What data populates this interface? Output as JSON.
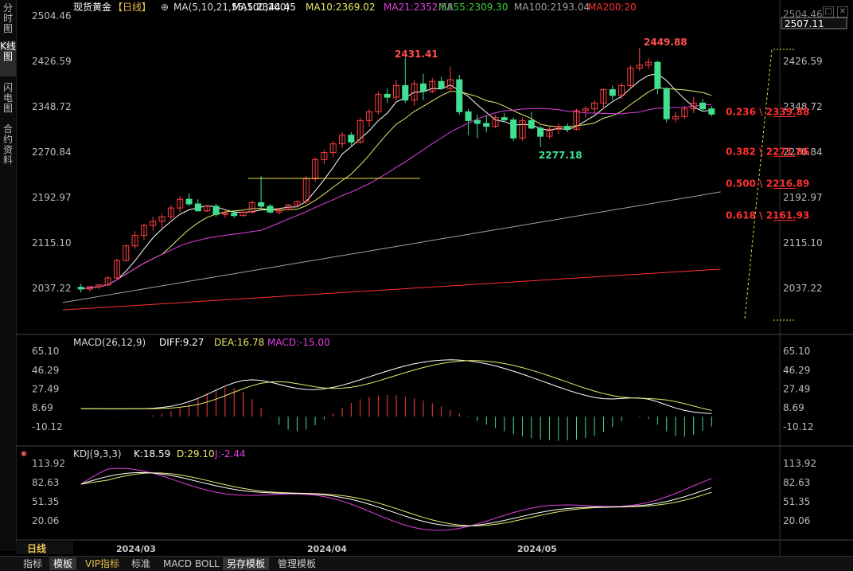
{
  "left_tabs": [
    {
      "label": "分时图",
      "active": false
    },
    {
      "label": "K线图",
      "active": true
    },
    {
      "label": "闪电图",
      "active": false
    },
    {
      "label": "合约资料",
      "active": false
    }
  ],
  "header": {
    "symbol": "现货黄金",
    "period": "【日线】",
    "settings_glyph": "⊕",
    "ma_params": "MA(5,10,21,55,100,200)",
    "ma": [
      {
        "label": "MA5:2344.45",
        "color": "#ffffff"
      },
      {
        "label": "MA10:2369.02",
        "color": "#e8e86a"
      },
      {
        "label": "MA21:2352.58",
        "color": "#e040e0"
      },
      {
        "label": "MA55:2309.30",
        "color": "#40d040"
      },
      {
        "label": "MA100:2193.04",
        "color": "#a0a0a0"
      },
      {
        "label": "MA200:20",
        "color": "#ff3030"
      }
    ]
  },
  "price_axis": {
    "ticks": [
      "2504.46",
      "2426.59",
      "2348.72",
      "2270.84",
      "2192.97",
      "2115.10",
      "2037.22"
    ],
    "current": "2507.11",
    "top_partial": "2504.46"
  },
  "annotations": {
    "high1": "2431.41",
    "high2": "2449.88",
    "low": "2277.18"
  },
  "fib": [
    {
      "ratio": "0.236",
      "value": "2339.88",
      "label": "0.236 \\ 2339.88"
    },
    {
      "ratio": "0.382",
      "value": "2271.86",
      "label": "0.382 \\ 2271.86"
    },
    {
      "ratio": "0.500",
      "value": "2216.89",
      "label": "0.500 \\ 2216.89"
    },
    {
      "ratio": "0.618",
      "value": "2161.93",
      "label": "0.618 \\ 2161.93"
    }
  ],
  "macd": {
    "title": "MACD(26,12,9)",
    "diff": "DIFF:9.27",
    "dea": "DEA:16.78",
    "macd": "MACD:-15.00",
    "ticks": [
      "65.10",
      "46.29",
      "27.49",
      "8.69",
      "-10.12"
    ],
    "colors": {
      "diff": "#ffffff",
      "dea": "#e8e86a",
      "macd": "#e040e0"
    }
  },
  "kdj": {
    "title": "KDJ(9,3,3)",
    "k": "K:18.59",
    "d": "D:29.10",
    "j": "J:-2.44",
    "ticks": [
      "113.92",
      "82.63",
      "51.35",
      "20.06"
    ],
    "colors": {
      "k": "#ffffff",
      "d": "#e8e86a",
      "j": "#e040e0"
    }
  },
  "time_axis": {
    "labels": [
      "2024/03",
      "2024/04",
      "2024/05"
    ],
    "period_label": "日线"
  },
  "bottom_tabs": [
    {
      "label": "指标",
      "active": false
    },
    {
      "label": "模板",
      "active": true
    },
    {
      "label": "VIP指标",
      "active": false,
      "vip": true
    },
    {
      "label": "标准",
      "active": false
    },
    {
      "label": "MACD",
      "active": false
    },
    {
      "label": "BOLL",
      "active": false
    },
    {
      "label": "另存模板",
      "active": true
    },
    {
      "label": "管理模板",
      "active": false
    }
  ],
  "colors": {
    "up": "#ff4040",
    "down": "#40e090",
    "bg": "#000000"
  },
  "candles": [
    [
      2039,
      2045,
      2030,
      2036
    ],
    [
      2036,
      2041,
      2032,
      2040
    ],
    [
      2040,
      2044,
      2036,
      2043
    ],
    [
      2043,
      2058,
      2041,
      2055
    ],
    [
      2055,
      2088,
      2053,
      2085
    ],
    [
      2085,
      2112,
      2083,
      2110
    ],
    [
      2110,
      2135,
      2105,
      2128
    ],
    [
      2128,
      2148,
      2120,
      2145
    ],
    [
      2145,
      2160,
      2136,
      2152
    ],
    [
      2152,
      2165,
      2140,
      2160
    ],
    [
      2160,
      2180,
      2155,
      2175
    ],
    [
      2175,
      2195,
      2168,
      2190
    ],
    [
      2190,
      2200,
      2178,
      2182
    ],
    [
      2182,
      2190,
      2170,
      2170
    ],
    [
      2170,
      2180,
      2168,
      2178
    ],
    [
      2178,
      2182,
      2160,
      2164
    ],
    [
      2164,
      2172,
      2158,
      2166
    ],
    [
      2166,
      2170,
      2158,
      2162
    ],
    [
      2162,
      2172,
      2160,
      2168
    ],
    [
      2168,
      2188,
      2165,
      2184
    ],
    [
      2184,
      2230,
      2172,
      2178
    ],
    [
      2178,
      2182,
      2165,
      2168
    ],
    [
      2168,
      2175,
      2164,
      2172
    ],
    [
      2172,
      2182,
      2170,
      2180
    ],
    [
      2180,
      2188,
      2176,
      2186
    ],
    [
      2186,
      2230,
      2182,
      2225
    ],
    [
      2225,
      2262,
      2220,
      2258
    ],
    [
      2258,
      2275,
      2250,
      2270
    ],
    [
      2270,
      2290,
      2262,
      2285
    ],
    [
      2285,
      2305,
      2278,
      2300
    ],
    [
      2300,
      2305,
      2282,
      2288
    ],
    [
      2288,
      2330,
      2285,
      2325
    ],
    [
      2325,
      2345,
      2315,
      2340
    ],
    [
      2340,
      2375,
      2335,
      2370
    ],
    [
      2370,
      2380,
      2355,
      2365
    ],
    [
      2365,
      2395,
      2360,
      2385
    ],
    [
      2385,
      2432,
      2355,
      2360
    ],
    [
      2360,
      2395,
      2350,
      2388
    ],
    [
      2388,
      2405,
      2360,
      2375
    ],
    [
      2375,
      2398,
      2372,
      2392
    ],
    [
      2392,
      2400,
      2378,
      2380
    ],
    [
      2380,
      2418,
      2374,
      2395
    ],
    [
      2395,
      2403,
      2335,
      2340
    ],
    [
      2340,
      2345,
      2300,
      2325
    ],
    [
      2325,
      2335,
      2295,
      2320
    ],
    [
      2320,
      2333,
      2305,
      2315
    ],
    [
      2315,
      2335,
      2312,
      2330
    ],
    [
      2330,
      2338,
      2322,
      2326
    ],
    [
      2326,
      2330,
      2290,
      2295
    ],
    [
      2295,
      2330,
      2290,
      2325
    ],
    [
      2325,
      2340,
      2310,
      2312
    ],
    [
      2312,
      2316,
      2280,
      2298
    ],
    [
      2298,
      2315,
      2294,
      2310
    ],
    [
      2310,
      2320,
      2302,
      2315
    ],
    [
      2315,
      2320,
      2305,
      2310
    ],
    [
      2310,
      2345,
      2308,
      2342
    ],
    [
      2342,
      2350,
      2330,
      2345
    ],
    [
      2345,
      2360,
      2338,
      2355
    ],
    [
      2355,
      2380,
      2345,
      2378
    ],
    [
      2378,
      2385,
      2360,
      2368
    ],
    [
      2368,
      2390,
      2362,
      2385
    ],
    [
      2385,
      2420,
      2380,
      2415
    ],
    [
      2415,
      2450,
      2410,
      2420
    ],
    [
      2420,
      2432,
      2413,
      2425
    ],
    [
      2425,
      2428,
      2370,
      2380
    ],
    [
      2380,
      2382,
      2322,
      2328
    ],
    [
      2328,
      2340,
      2322,
      2332
    ],
    [
      2332,
      2350,
      2328,
      2345
    ],
    [
      2345,
      2365,
      2338,
      2355
    ],
    [
      2355,
      2362,
      2340,
      2345
    ],
    [
      2345,
      2350,
      2332,
      2336
    ]
  ]
}
